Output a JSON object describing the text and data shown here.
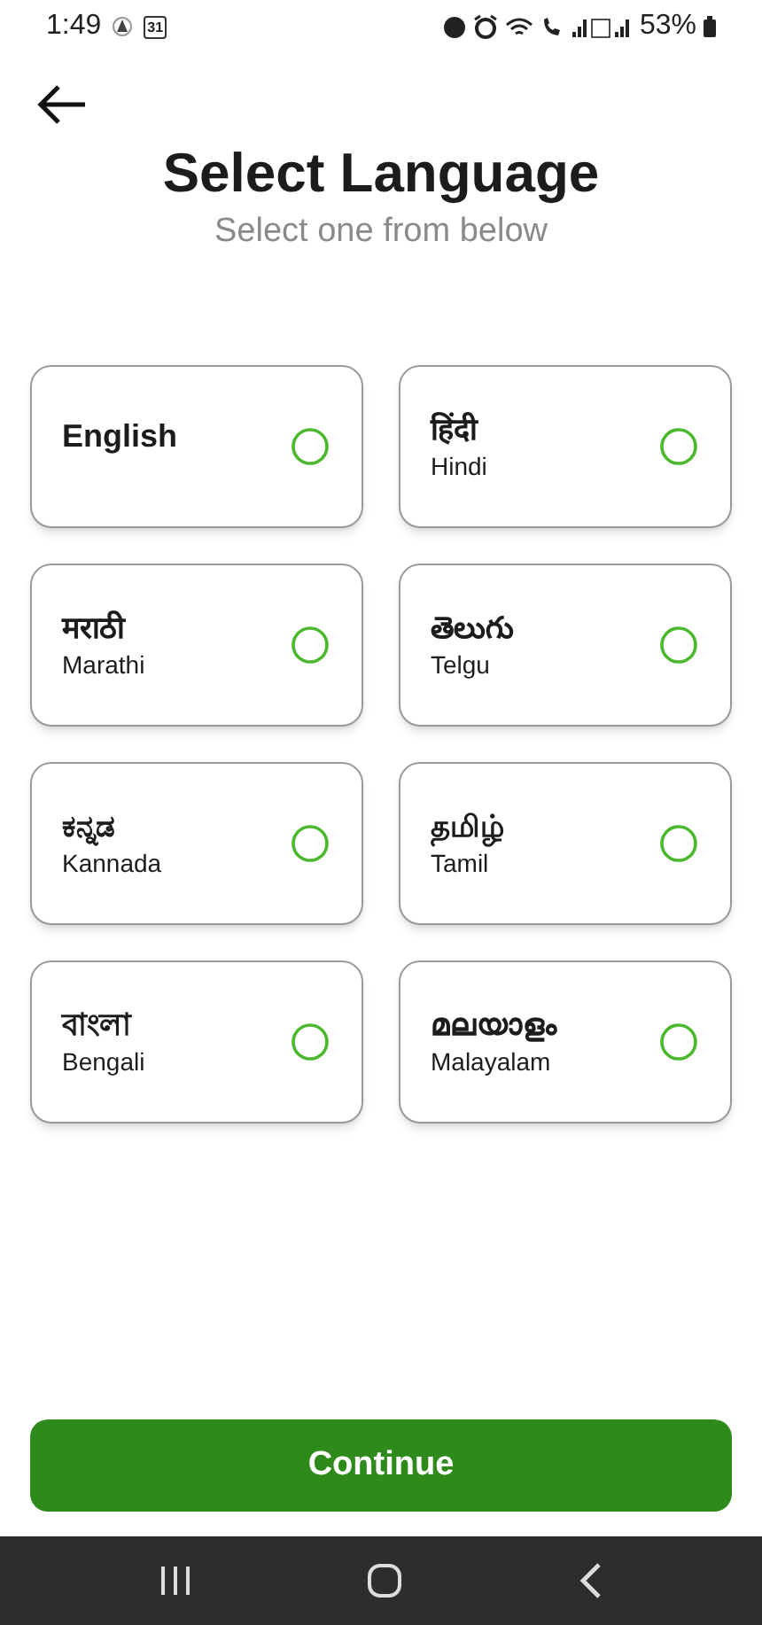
{
  "status_bar": {
    "time": "1:49",
    "calendar_day": "31",
    "battery": "53%"
  },
  "header": {
    "title": "Select Language",
    "subtitle": "Select one from below"
  },
  "languages": [
    {
      "name": "English",
      "selected": false
    },
    {
      "name": "हिंदी",
      "english_name": "Hindi",
      "selected": false
    },
    {
      "name": "मराठी",
      "english_name": "Marathi",
      "selected": false
    },
    {
      "name": "తెలుగు",
      "english_name": "Telgu",
      "selected": false
    },
    {
      "name": "ಕನ್ನಡ",
      "english_name": "Kannada",
      "selected": false
    },
    {
      "name": "தமிழ்",
      "english_name": "Tamil",
      "selected": false
    },
    {
      "name": "বাংলা",
      "english_name": "Bengali",
      "selected": false
    },
    {
      "name": "മലയാളം",
      "english_name": "Malayalam",
      "selected": false
    }
  ],
  "continue_button": "Continue"
}
